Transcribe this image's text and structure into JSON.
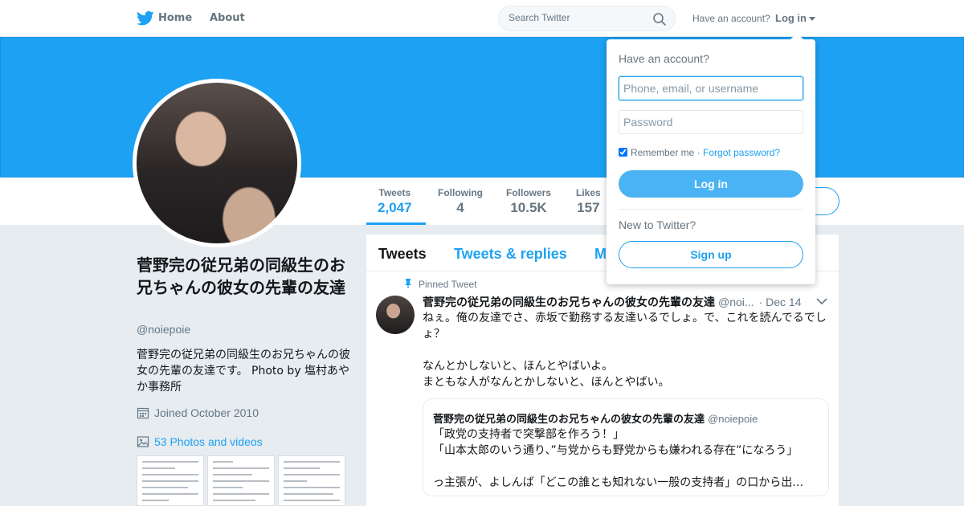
{
  "colors": {
    "brand": "#1da1f2",
    "text": "#14171a",
    "muted": "#657786",
    "background": "#e6ecf0"
  },
  "topnav": {
    "logo_icon": "twitter-bird-icon",
    "home_label": "Home",
    "about_label": "About",
    "search_placeholder": "Search Twitter",
    "search_icon": "search-icon",
    "have_account_text": "Have an account?",
    "login_label": "Log in"
  },
  "profile": {
    "name": "菅野完の従兄弟の同級生のお兄ちゃんの彼女の先輩の友達",
    "handle": "@noiepoie",
    "bio": "菅野完の従兄弟の同級生のお兄ちゃんの彼女の先輩の友達です。 Photo by 塩村あやか事務所",
    "joined": "Joined October 2010",
    "photos_link": "53 Photos and videos"
  },
  "stats": [
    {
      "label": "Tweets",
      "value": "2,047",
      "active": true
    },
    {
      "label": "Following",
      "value": "4",
      "active": false
    },
    {
      "label": "Followers",
      "value": "10.5K",
      "active": false
    },
    {
      "label": "Likes",
      "value": "157",
      "active": false
    }
  ],
  "timeline": {
    "tabs": [
      "Tweets",
      "Tweets & replies",
      "M"
    ],
    "pinned_label": "Pinned Tweet",
    "tweet": {
      "name": "菅野完の従兄弟の同級生のお兄ちゃんの彼女の先輩の友達",
      "handle": "@noi...",
      "date": "· Dec 14",
      "text": "ねぇ。俺の友達でさ、赤坂で勤務する友達いるでしょ。で、これを読んでるでしょ？\n\nなんとかしないと、ほんとやばいよ。\nまともな人がなんとかしないと、ほんとやばい。"
    },
    "quote": {
      "name": "菅野完の従兄弟の同級生のお兄ちゃんの彼女の先輩の友達",
      "handle": "@noiepoie",
      "text": "「政党の支持者で突撃部を作ろう！」\n「山本太郎のいう通り、”与党からも野党からも嫌われる存在”になろう」\n\nっ主張が、よしんば「どこの誰とも知れない一般の支持者」の口から出…"
    }
  },
  "login_dropdown": {
    "title": "Have an account?",
    "username_placeholder": "Phone, email, or username",
    "password_placeholder": "Password",
    "remember_label": "Remember me",
    "separator": "·",
    "forgot_label": "Forgot password?",
    "login_button": "Log in",
    "new_label": "New to Twitter?",
    "signup_button": "Sign up"
  }
}
